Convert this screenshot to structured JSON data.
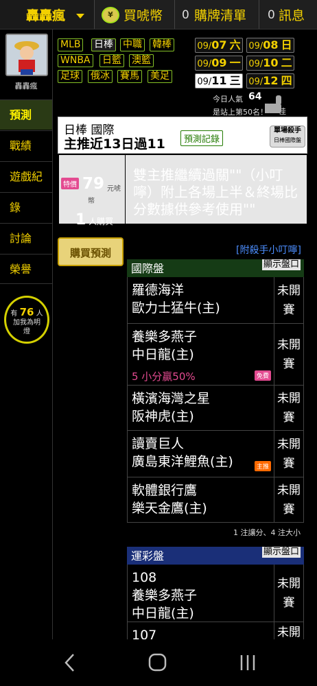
{
  "topbar": {
    "user_name": "轟轟瘋",
    "buy_coins_label": "買唬幣",
    "list_count": "0",
    "list_label": "購牌清單",
    "msg_count": "0",
    "msg_label": "訊息"
  },
  "sidebar": {
    "user_label": "轟轟瘋",
    "items": [
      {
        "label": "預測",
        "active": true
      },
      {
        "label": "戰績"
      },
      {
        "label": "遊戲紀"
      },
      {
        "label": "錄"
      },
      {
        "label": "討論"
      },
      {
        "label": "榮譽"
      }
    ],
    "bulb": {
      "prefix": "有",
      "count": "76",
      "suffix": "人",
      "line2": "加我為明",
      "line3": "燈"
    }
  },
  "leagues": [
    {
      "label": "MLB"
    },
    {
      "label": "日棒"
    },
    {
      "label": "中職"
    },
    {
      "label": "韓棒"
    },
    {
      "label": "WNBA"
    },
    {
      "label": "日籃"
    },
    {
      "label": "澳籃"
    },
    {
      "label": "足球"
    },
    {
      "label": "俄冰"
    },
    {
      "label": "賽馬"
    },
    {
      "label": "美足"
    }
  ],
  "dates": [
    {
      "md": "09/",
      "day": "07",
      "wd": "六"
    },
    {
      "md": "09/",
      "day": "08",
      "wd": "日"
    },
    {
      "md": "09/",
      "day": "09",
      "wd": "一"
    },
    {
      "md": "09/",
      "day": "10",
      "wd": "二"
    },
    {
      "md": "09/",
      "day": "11",
      "wd": "三"
    },
    {
      "md": "09/",
      "day": "12",
      "wd": "四"
    }
  ],
  "popularity": {
    "label": "今日人氣",
    "value": "64",
    "rank_text": "是站上第50名！",
    "rank_suffix": "佳"
  },
  "card": {
    "line1": "日棒 國際",
    "line2": "主推近13日過11",
    "record_button": "預測記錄",
    "badge_line1": "單場殺手",
    "badge_line2": "日棒國際盤"
  },
  "price": {
    "tag": "特價",
    "amount": "79",
    "unit": "元唬",
    "unit2": "幣",
    "buyers_count": "1",
    "buyers_label": "人購買",
    "buy_button": "購買預測"
  },
  "description": "雙主推繼續過關\"\"（小叮嚀）附上各場上半＆終場比分數據供參考使用\"\"",
  "attach_link": "[附殺手小叮嚀]",
  "intl_table": {
    "title": "國際盤",
    "show_button": "顯示盤口",
    "rows": [
      {
        "team1": "羅德海洋",
        "team2": "歐力士猛牛(主)",
        "status1": "未開",
        "status2": "賽"
      },
      {
        "team1": "養樂多燕子",
        "team2": "中日龍(主)",
        "extra": "5 小分贏50%",
        "free": "免費",
        "status1": "未開",
        "status2": "賽"
      },
      {
        "team1": "橫濱海灣之星",
        "team2": "阪神虎(主)",
        "status1": "未開",
        "status2": "賽"
      },
      {
        "team1": "讀賣巨人",
        "team2": "廣島東洋鯉魚(主)",
        "major": "主推",
        "status1": "未開",
        "status2": "賽"
      },
      {
        "team1": "軟體銀行鷹",
        "team2": "樂天金鷹(主)",
        "status1": "未開",
        "status2": "賽"
      }
    ],
    "note": "1 注讓分、4 注大小"
  },
  "lottery_table": {
    "title": "運彩盤",
    "show_button": "顯示盤口",
    "rows": [
      {
        "num": "108",
        "team1": "養樂多燕子",
        "team2": "中日龍(主)",
        "status1": "未開",
        "status2": "賽"
      },
      {
        "num": "107",
        "status1": "未開"
      }
    ]
  },
  "colors": {
    "accent_yellow": "#f2d000",
    "pink": "#e34a90",
    "green_header": "#153b15",
    "blue_header": "#1a2f78"
  }
}
